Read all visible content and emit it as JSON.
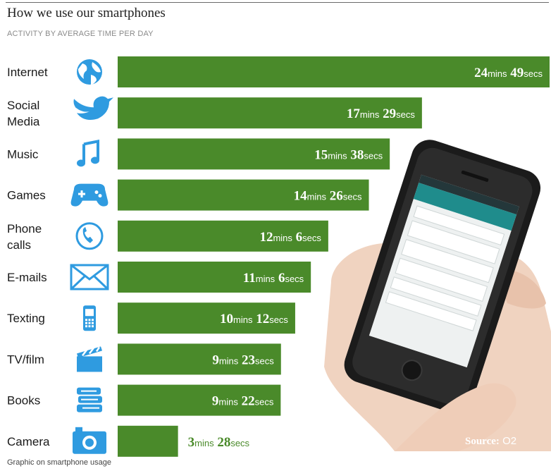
{
  "chart_data": {
    "type": "bar",
    "title": "How we use our smartphones",
    "subtitle": "ACTIVITY BY AVERAGE TIME PER DAY",
    "categories": [
      "Internet",
      "Social Media",
      "Music",
      "Games",
      "Phone calls",
      "E-mails",
      "Texting",
      "TV/film",
      "Books",
      "Camera"
    ],
    "category_lines": [
      [
        "Internet"
      ],
      [
        "Social",
        "Media"
      ],
      [
        "Music"
      ],
      [
        "Games"
      ],
      [
        "Phone",
        "calls"
      ],
      [
        "E-mails"
      ],
      [
        "Texting"
      ],
      [
        "TV/film"
      ],
      [
        "Books"
      ],
      [
        "Camera"
      ]
    ],
    "icons": [
      "globe-icon",
      "bird-icon",
      "music-note-icon",
      "gamepad-icon",
      "phone-icon",
      "envelope-icon",
      "mobile-phone-icon",
      "clapperboard-icon",
      "books-icon",
      "camera-icon"
    ],
    "values_seconds": [
      1489,
      1049,
      938,
      866,
      726,
      666,
      612,
      563,
      562,
      208
    ],
    "labels": [
      {
        "mins": "24",
        "secs": "49"
      },
      {
        "mins": "17",
        "secs": "29"
      },
      {
        "mins": "15",
        "secs": "38"
      },
      {
        "mins": "14",
        "secs": "26"
      },
      {
        "mins": "12",
        "secs": "6"
      },
      {
        "mins": "11",
        "secs": "6"
      },
      {
        "mins": "10",
        "secs": "12"
      },
      {
        "mins": "9",
        "secs": "23"
      },
      {
        "mins": "9",
        "secs": "22"
      },
      {
        "mins": "3",
        "secs": "28"
      }
    ],
    "unit_mins": "mins",
    "unit_secs": "secs",
    "xlabel": "",
    "ylabel": "",
    "grid": false,
    "legend": "none",
    "colors": {
      "bar": "#4a8a2a",
      "icon": "#2f9be0",
      "label_outside": "#4a8a2a"
    }
  },
  "source_label": "Source:",
  "source_name": "O2",
  "caption": "Graphic on smartphone usage"
}
